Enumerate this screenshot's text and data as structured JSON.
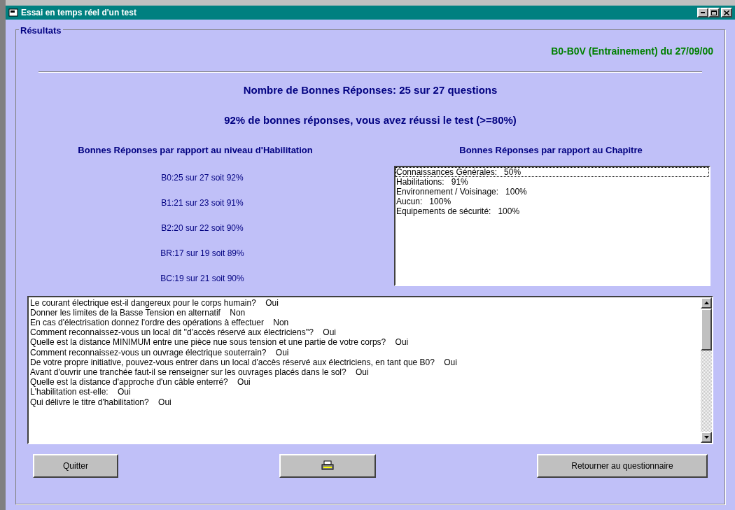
{
  "window": {
    "title": "Essai en temps réel d'un test"
  },
  "group": {
    "title": "Résultats"
  },
  "test_name": "B0-B0V (Entrainement) du 27/09/00",
  "summary": [
    "Nombre de Bonnes Réponses: 25 sur 27 questions",
    "92% de bonnes réponses, vous avez réussi le test (>=80%)"
  ],
  "levels": {
    "heading": "Bonnes Réponses par rapport au niveau d'Habilitation",
    "items": [
      "B0:25 sur 27 soit 92%",
      "B1:21 sur 23 soit 91%",
      "B2:20 sur 22 soit 90%",
      "BR:17 sur 19 soit 89%",
      "BC:19 sur 21 soit 90%"
    ]
  },
  "chapters": {
    "heading": "Bonnes Réponses par rapport au Chapitre",
    "items": [
      {
        "text": "Connaissances Générales:   50%",
        "selected": true
      },
      {
        "text": "Habilitations:   91%",
        "selected": false
      },
      {
        "text": "Environnement / Voisinage:   100%",
        "selected": false
      },
      {
        "text": "Aucun:   100%",
        "selected": false
      },
      {
        "text": "Equipements de sécurité:   100%",
        "selected": false
      }
    ]
  },
  "answers": [
    "Le courant électrique est-il dangereux pour le corps humain?    Oui",
    "Donner les limites de la Basse Tension en alternatif    Non",
    "En cas d'électrisation donnez l'ordre des opérations à effectuer    Non",
    "Comment reconnaissez-vous un local dit ''d'accès réservé aux électriciens''?    Oui",
    "Quelle est la distance MINIMUM entre une pièce nue sous tension et une partie de votre corps?    Oui",
    "Comment reconnaissez-vous un ouvrage électrique souterrain?    Oui",
    "De votre propre initiative, pouvez-vous entrer dans un local d'accès réservé aux électriciens, en tant que B0?    Oui",
    "Avant d'ouvrir une tranchée faut-il se renseigner sur les ouvrages placés dans le sol?    Oui",
    "Quelle est la distance d'approche d'un câble enterré?    Oui",
    "L'habilitation est-elle:    Oui",
    "Qui délivre le titre d'habilitation?    Oui"
  ],
  "buttons": {
    "quit": "Quitter",
    "back": "Retourner au questionnaire"
  }
}
